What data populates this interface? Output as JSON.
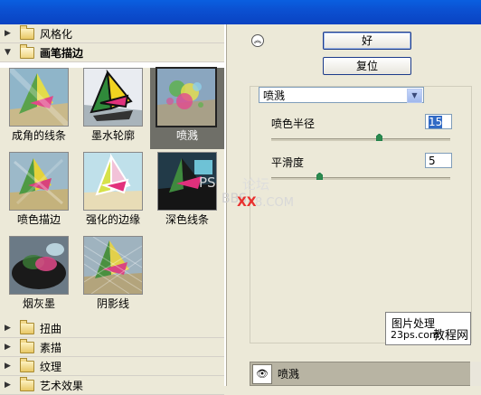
{
  "categories_top": [
    {
      "label": "风格化",
      "open": false
    },
    {
      "label": "画笔描边",
      "open": true
    }
  ],
  "thumbnails": [
    {
      "label": "成角的线条",
      "selected": false
    },
    {
      "label": "墨水轮廓",
      "selected": false
    },
    {
      "label": "喷溅",
      "selected": true
    },
    {
      "label": "喷色描边",
      "selected": false
    },
    {
      "label": "强化的边缘",
      "selected": false
    },
    {
      "label": "深色线条",
      "selected": false
    },
    {
      "label": "烟灰墨",
      "selected": false
    },
    {
      "label": "阴影线",
      "selected": false
    }
  ],
  "categories_bottom": [
    {
      "label": "扭曲",
      "open": false
    },
    {
      "label": "素描",
      "open": false
    },
    {
      "label": "纹理",
      "open": false
    },
    {
      "label": "艺术效果",
      "open": false
    }
  ],
  "buttons": {
    "ok": "好",
    "reset": "复位"
  },
  "filter_select": {
    "value": "喷溅"
  },
  "params": [
    {
      "label": "喷色半径",
      "value": "15",
      "fraction": 0.6
    },
    {
      "label": "平滑度",
      "value": "5",
      "fraction": 0.27
    }
  ],
  "watermarks": {
    "center_top": "PS",
    "center_mid": "论坛",
    "center_bottom_a": "XX",
    "center_bottom_b": "8.COM",
    "center_bottom_c": "BBS.",
    "preview_l1": "图片处理",
    "preview_l2": "23ps.com",
    "preview_l3": "教程网"
  },
  "layer": {
    "label": "喷溅"
  },
  "icons": [
    "triangle-right-icon",
    "triangle-down-icon",
    "folder-icon",
    "collapse-chevrons-icon",
    "dropdown-arrow-icon",
    "eye-icon",
    "slider-knob-icon"
  ]
}
